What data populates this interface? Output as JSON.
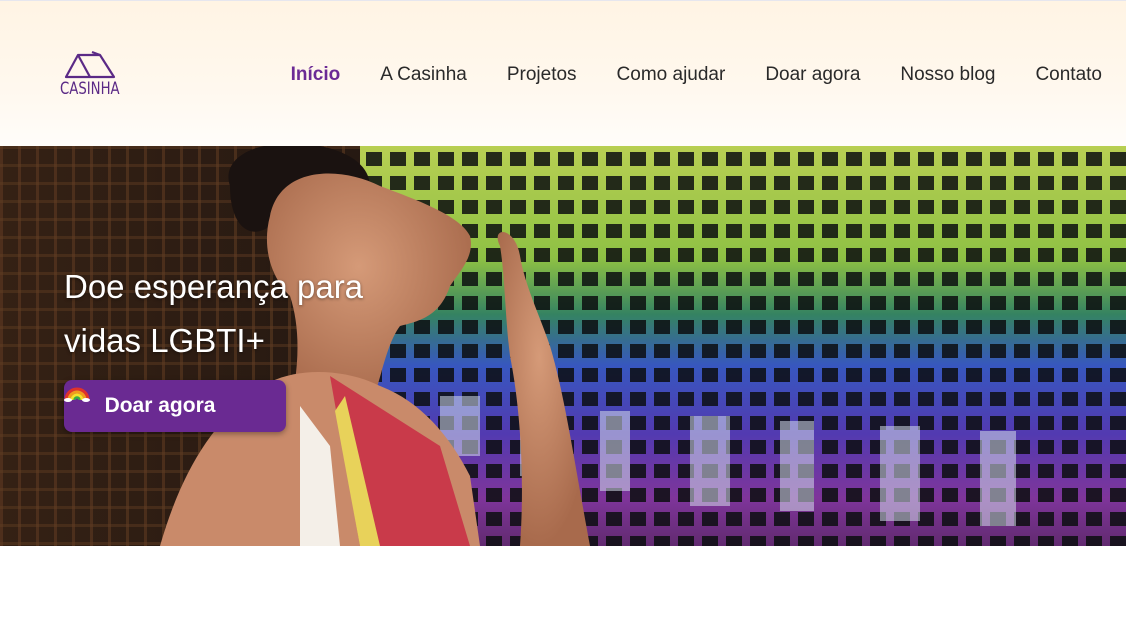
{
  "brand": {
    "logo_text": "CASINHA",
    "accent_color": "#6b2a95"
  },
  "nav": {
    "items": [
      {
        "label": "Início",
        "active": true
      },
      {
        "label": "A Casinha",
        "active": false
      },
      {
        "label": "Projetos",
        "active": false
      },
      {
        "label": "Como ajudar",
        "active": false
      },
      {
        "label": "Doar agora",
        "active": false
      },
      {
        "label": "Nosso blog",
        "active": false
      },
      {
        "label": "Contato",
        "active": false
      }
    ]
  },
  "hero": {
    "headline": "Doe esperança para vidas LGBTI+",
    "cta_label": "Doar agora",
    "cta_icon": "rainbow-emoji-icon",
    "image": "person-blowing-kiss-rainbow-grid-photo",
    "cta_color": "#6a2a92"
  }
}
